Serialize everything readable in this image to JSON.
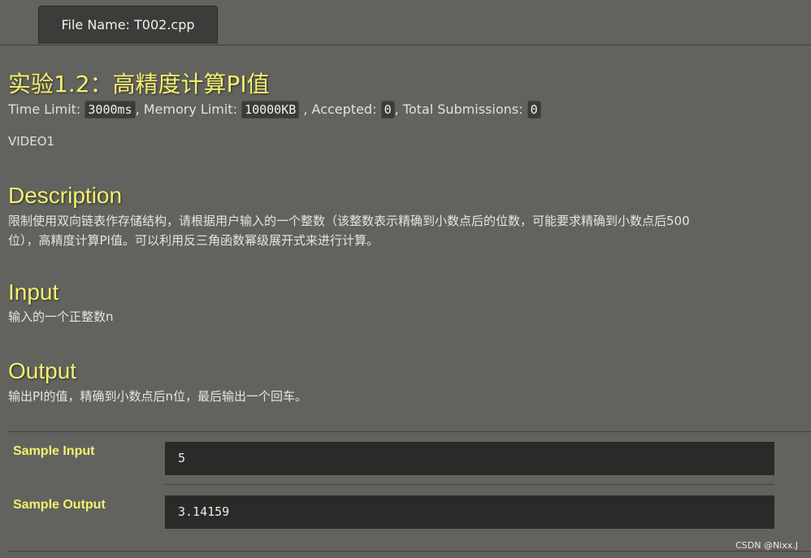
{
  "tab": {
    "prefix": "File Name:",
    "value": "T002.cpp"
  },
  "problem": {
    "title": "实验1.2：高精度计算PI值",
    "meta": {
      "time_label": "Time Limit:",
      "time_value": "3000ms",
      "memory_label": ", Memory Limit:",
      "memory_value": "10000KB",
      "accepted_label": ", Accepted:",
      "accepted_value": "0",
      "total_label": ", Total Submissions:",
      "total_value": "0"
    },
    "video": "VIDEO1"
  },
  "description": {
    "heading": "Description",
    "line1": "限制使用双向链表作存储结构，请根据用户输入的一个整数（该整数表示精确到小数点后的位数，可能要求精确到小数点后500",
    "line2": "位），高精度计算PI值。可以利用反三角函数幂级展开式来进行计算。"
  },
  "input": {
    "heading": "Input",
    "text": "输入的一个正整数n"
  },
  "output": {
    "heading": "Output",
    "text": "输出PI的值，精确到小数点后n位，最后输出一个回车。"
  },
  "samples": {
    "input_label": "Sample Input",
    "input_value": "5",
    "output_label": "Sample Output",
    "output_value": "3.14159"
  },
  "footer": {
    "watermark": "CSDN @Nixx.J"
  }
}
